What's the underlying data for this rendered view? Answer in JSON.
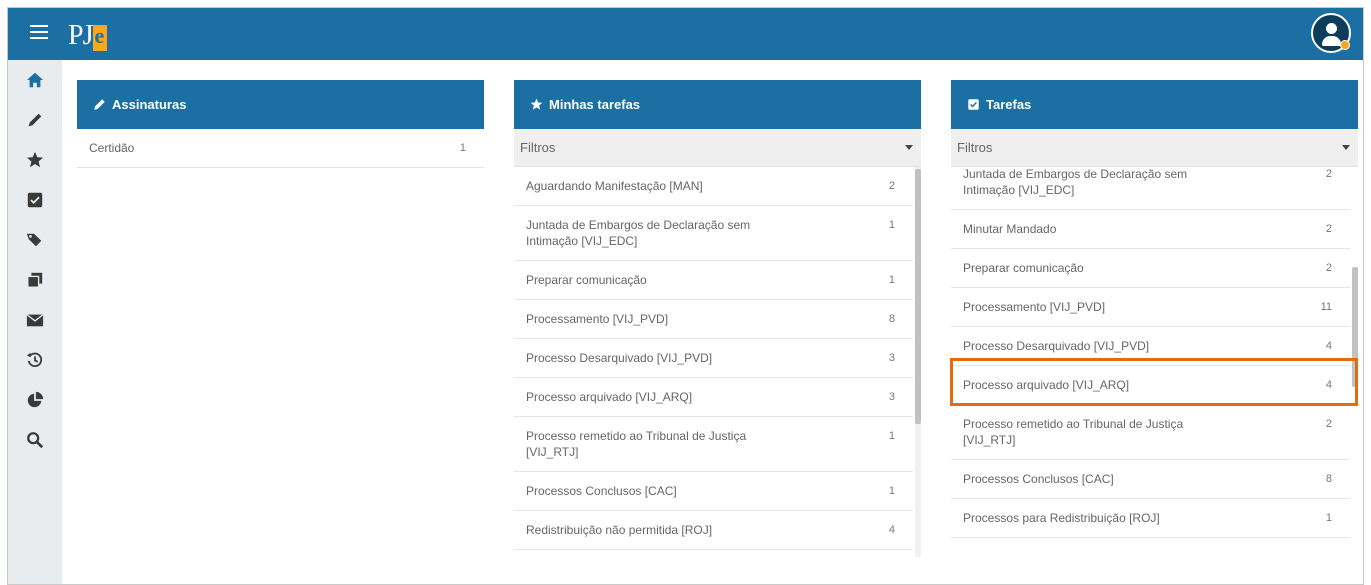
{
  "header": {
    "logo_text": "PJ",
    "logo_accent": "e"
  },
  "sidebar": {
    "items": [
      {
        "name": "home-icon"
      },
      {
        "name": "pencil-icon"
      },
      {
        "name": "star-icon"
      },
      {
        "name": "checkbox-icon"
      },
      {
        "name": "tags-icon"
      },
      {
        "name": "copy-icon"
      },
      {
        "name": "envelope-icon"
      },
      {
        "name": "history-icon"
      },
      {
        "name": "pie-chart-icon"
      },
      {
        "name": "search-icon"
      }
    ]
  },
  "assinaturas": {
    "title": "Assinaturas",
    "rows": [
      {
        "label": "Certidão",
        "count": "1"
      }
    ]
  },
  "minhas_tarefas": {
    "title": "Minhas tarefas",
    "filter_label": "Filtros",
    "rows": [
      {
        "label": "Aguardando Manifestação [MAN]",
        "count": "2"
      },
      {
        "label": "Juntada de Embargos de Declaração sem Intimação [VIJ_EDC]",
        "count": "1"
      },
      {
        "label": "Preparar comunicação",
        "count": "1"
      },
      {
        "label": "Processamento [VIJ_PVD]",
        "count": "8"
      },
      {
        "label": "Processo Desarquivado [VIJ_PVD]",
        "count": "3"
      },
      {
        "label": "Processo arquivado [VIJ_ARQ]",
        "count": "3"
      },
      {
        "label": "Processo remetido ao Tribunal de Justiça [VIJ_RTJ]",
        "count": "1"
      },
      {
        "label": "Processos Conclusos [CAC]",
        "count": "1"
      },
      {
        "label": "Redistribuição não permitida [ROJ]",
        "count": "4"
      }
    ]
  },
  "tarefas": {
    "title": "Tarefas",
    "filter_label": "Filtros",
    "rows": [
      {
        "label": "Juntada de Embargos de Declaração sem Intimação [VIJ_EDC]",
        "count": "2"
      },
      {
        "label": "Minutar Mandado",
        "count": "2"
      },
      {
        "label": "Preparar comunicação",
        "count": "2"
      },
      {
        "label": "Processamento [VIJ_PVD]",
        "count": "11"
      },
      {
        "label": "Processo Desarquivado [VIJ_PVD]",
        "count": "4"
      },
      {
        "label": "Processo arquivado [VIJ_ARQ]",
        "count": "4"
      },
      {
        "label": "Processo remetido ao Tribunal de Justiça [VIJ_RTJ]",
        "count": "2"
      },
      {
        "label": "Processos Conclusos [CAC]",
        "count": "8"
      },
      {
        "label": "Processos para Redistribuição [ROJ]",
        "count": "1"
      }
    ],
    "highlighted_row": "Processo arquivado [VIJ_ARQ]"
  },
  "colors": {
    "primary": "#1b6fa2",
    "accent": "#f7a81b",
    "highlight": "#e36b10"
  }
}
